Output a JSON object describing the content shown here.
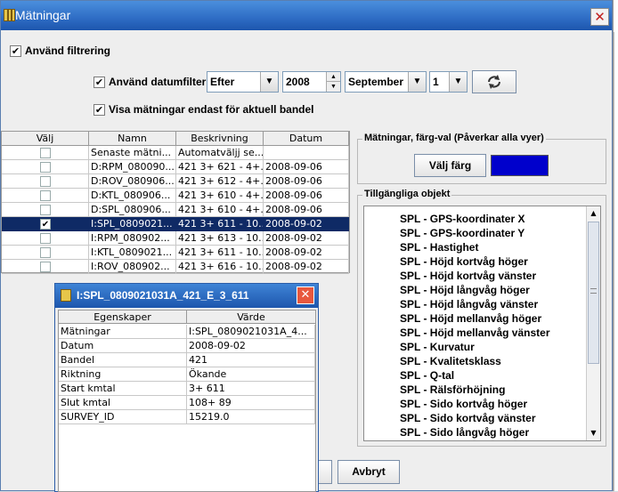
{
  "window": {
    "title": "Mätningar",
    "close_glyph": "✕"
  },
  "filters": {
    "use_filter_label": "Använd filtrering",
    "use_filter_checked": "✔",
    "use_date_filter_label": "Använd datumfilter",
    "use_date_filter_checked": "✔",
    "date_mode": "Efter",
    "year": "2008",
    "month": "September",
    "day": "1",
    "show_current_label": "Visa mätningar endast för aktuell bandel",
    "show_current_checked": "✔"
  },
  "table": {
    "columns": [
      "Välj",
      "Namn",
      "Beskrivning",
      "Datum"
    ],
    "rows": [
      {
        "checked": "",
        "name": "Senaste mätni...",
        "desc": "Automatväljj se...",
        "date": ""
      },
      {
        "checked": "",
        "name": "D:RPM_080090...",
        "desc": "421 3+ 621 - 4+...",
        "date": "2008-09-06"
      },
      {
        "checked": "",
        "name": "D:ROV_080906...",
        "desc": "421 3+ 612 - 4+...",
        "date": "2008-09-06"
      },
      {
        "checked": "",
        "name": "D:KTL_080906...",
        "desc": "421 3+ 610 - 4+...",
        "date": "2008-09-06"
      },
      {
        "checked": "",
        "name": "D:SPL_080906...",
        "desc": "421 3+ 610 - 4+...",
        "date": "2008-09-06"
      },
      {
        "checked": "✔",
        "name": "I:SPL_0809021...",
        "desc": "421 3+ 611 - 10...",
        "date": "2008-09-02"
      },
      {
        "checked": "",
        "name": "I:RPM_080902...",
        "desc": "421 3+ 613 - 10...",
        "date": "2008-09-02"
      },
      {
        "checked": "",
        "name": "I:KTL_0809021...",
        "desc": "421 3+ 611 - 10...",
        "date": "2008-09-02"
      },
      {
        "checked": "",
        "name": "I:ROV_080902...",
        "desc": "421 3+ 616 - 10...",
        "date": "2008-09-02"
      }
    ]
  },
  "color_panel": {
    "legend": "Mätningar, färg-val (Påverkar alla vyer)",
    "button": "Välj färg",
    "swatch_color": "#0000cc"
  },
  "objects_panel": {
    "legend": "Tillgängliga objekt",
    "items": [
      "SPL - GPS-koordinater X",
      "SPL - GPS-koordinater Y",
      "SPL - Hastighet",
      "SPL - Höjd kortvåg höger",
      "SPL - Höjd kortvåg vänster",
      "SPL - Höjd långvåg höger",
      "SPL - Höjd långvåg vänster",
      "SPL - Höjd mellanvåg höger",
      "SPL - Höjd mellanvåg vänster",
      "SPL - Kurvatur",
      "SPL - Kvalitetsklass",
      "SPL - Q-tal",
      "SPL - Rälsförhöjning",
      "SPL - Sido kortvåg höger",
      "SPL - Sido kortvåg vänster",
      "SPL - Sido långvåg höger"
    ]
  },
  "footer": {
    "cancel": "Avbryt"
  },
  "popup": {
    "title": "I:SPL_0809021031A_421_E_3_611",
    "close_glyph": "✕",
    "columns": [
      "Egenskaper",
      "Värde"
    ],
    "rows": [
      {
        "key": "Mätningar",
        "value": "I:SPL_0809021031A_4..."
      },
      {
        "key": "Datum",
        "value": "2008-09-02"
      },
      {
        "key": "Bandel",
        "value": "421"
      },
      {
        "key": "Riktning",
        "value": "Ökande"
      },
      {
        "key": "Start kmtal",
        "value": "3+ 611"
      },
      {
        "key": "Slut kmtal",
        "value": "108+  89"
      },
      {
        "key": "SURVEY_ID",
        "value": "15219.0"
      }
    ]
  }
}
